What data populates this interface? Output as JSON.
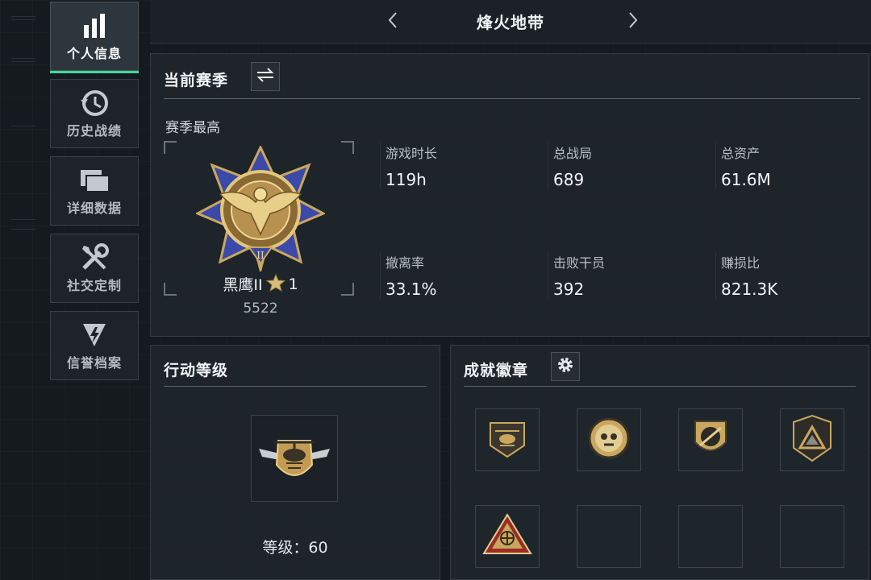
{
  "sidebar": {
    "items": [
      {
        "label": "个人信息",
        "icon": "bar-chart-icon",
        "active": true
      },
      {
        "label": "历史战绩",
        "icon": "history-clock-icon",
        "active": false
      },
      {
        "label": "详细数据",
        "icon": "folders-icon",
        "active": false
      },
      {
        "label": "社交定制",
        "icon": "wrench-screwdriver-icon",
        "active": false
      },
      {
        "label": "信誉档案",
        "icon": "credit-shield-icon",
        "active": false
      }
    ]
  },
  "header": {
    "title": "烽火地带",
    "prev_icon": "chevron-left-icon",
    "next_icon": "chevron-right-icon"
  },
  "season": {
    "title": "当前赛季",
    "switch_icon": "swap-arrows-icon",
    "best_label": "赛季最高",
    "rank_name": "黑鹰II",
    "rank_stars": "1",
    "rank_score": "5522",
    "rank_emblem_numeral": "II",
    "stats": [
      {
        "label": "游戏时长",
        "value": "119h"
      },
      {
        "label": "总战局",
        "value": "689"
      },
      {
        "label": "总资产",
        "value": "61.6M"
      },
      {
        "label": "撤离率",
        "value": "33.1%"
      },
      {
        "label": "击败干员",
        "value": "392"
      },
      {
        "label": "赚损比",
        "value": "821.3K"
      }
    ]
  },
  "operation": {
    "title": "行动等级",
    "level_label": "等级：",
    "level_value": "60",
    "emblem_icon": "helicopter-wings-emblem-icon"
  },
  "badges": {
    "title": "成就徽章",
    "settings_icon": "gear-icon",
    "slots": [
      {
        "icon": "helicopter-badge-icon",
        "filled": true
      },
      {
        "icon": "skull-coin-badge-icon",
        "filled": true
      },
      {
        "icon": "rifle-shield-badge-icon",
        "filled": true
      },
      {
        "icon": "triangle-shield-badge-icon",
        "filled": true
      },
      {
        "icon": "radar-triangle-badge-icon",
        "filled": true
      },
      {
        "icon": "",
        "filled": false
      },
      {
        "icon": "",
        "filled": false
      },
      {
        "icon": "",
        "filled": false
      }
    ]
  },
  "colors": {
    "accent": "#43d79a",
    "gold": "#c9a75e",
    "rank_blue": "#3b4aa8"
  }
}
